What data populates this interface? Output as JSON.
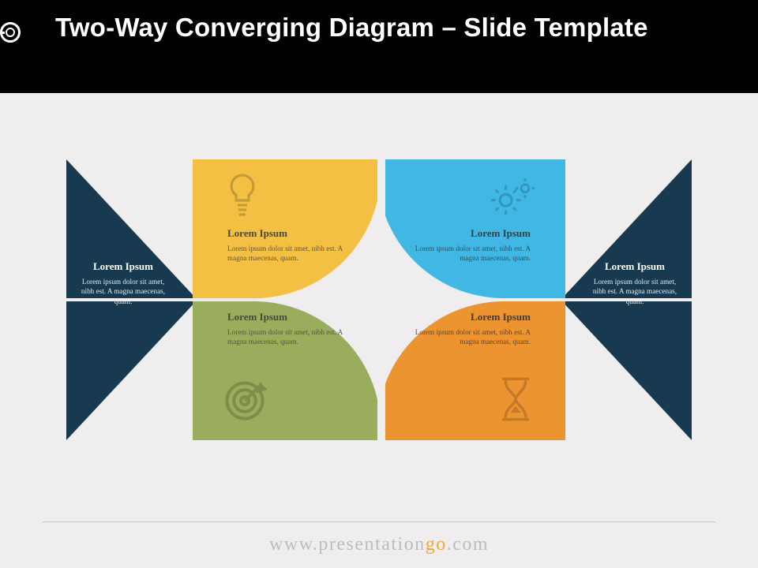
{
  "title": "Two-Way Converging Diagram – Slide Template",
  "footer": {
    "pre": "www.presentation",
    "accent": "go",
    "post": ".com"
  },
  "colors": {
    "bg": "#efeded",
    "dark": "#173a50",
    "yellow": "#f3c044",
    "green": "#9aad5c",
    "blue": "#41b8e4",
    "orange": "#ec9430"
  },
  "segments": {
    "left_outer": {
      "title": "Lorem Ipsum",
      "body": "Lorem ipsum dolor sit amet, nibh est. A magna maecenas, quam."
    },
    "right_outer": {
      "title": "Lorem Ipsum",
      "body": "Lorem ipsum dolor sit amet, nibh est. A magna maecenas, quam."
    },
    "top_left": {
      "icon": "lightbulb",
      "title": "Lorem Ipsum",
      "body": "Lorem ipsum dolor sit amet, nibh est. A magna maecenas, quam."
    },
    "bottom_left": {
      "icon": "target",
      "title": "Lorem Ipsum",
      "body": "Lorem ipsum dolor sit amet, nibh est. A magna maecenas, quam."
    },
    "top_right": {
      "icon": "gears",
      "title": "Lorem Ipsum",
      "body": "Lorem ipsum dolor sit amet, nibh est. A magna maecenas, quam."
    },
    "bottom_right": {
      "icon": "hourglass",
      "title": "Lorem Ipsum",
      "body": "Lorem ipsum dolor sit amet, nibh est. A magna maecenas, quam."
    }
  }
}
